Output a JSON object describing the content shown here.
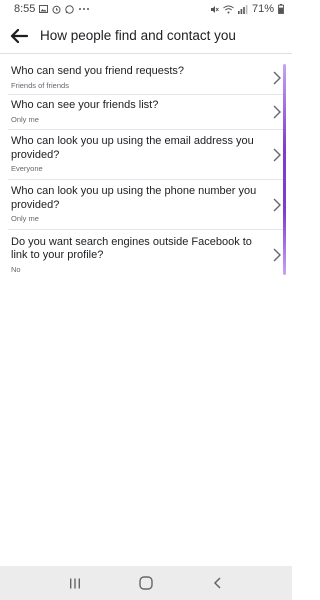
{
  "status_bar": {
    "time": "8:55",
    "battery": "71%"
  },
  "header": {
    "title": "How people find and contact you"
  },
  "settings": [
    {
      "question": "Who can send you friend requests?",
      "value": "Friends of friends"
    },
    {
      "question": "Who can see your friends list?",
      "value": "Only me"
    },
    {
      "question": "Who can look you up using the email address you provided?",
      "value": "Everyone"
    },
    {
      "question": "Who can look you up using the phone number you provided?",
      "value": "Only me"
    },
    {
      "question": "Do you want search engines outside Facebook to link to your profile?",
      "value": "No"
    }
  ],
  "colors": {
    "highlight": "#7d3dd1",
    "divider": "#e4e6eb",
    "secondary_text": "#65676b"
  },
  "icons": {
    "back": "arrow-left-icon",
    "chevron": "chevron-right-icon",
    "nav_recents": "recents-icon",
    "nav_home": "home-icon",
    "nav_back": "nav-back-icon"
  }
}
